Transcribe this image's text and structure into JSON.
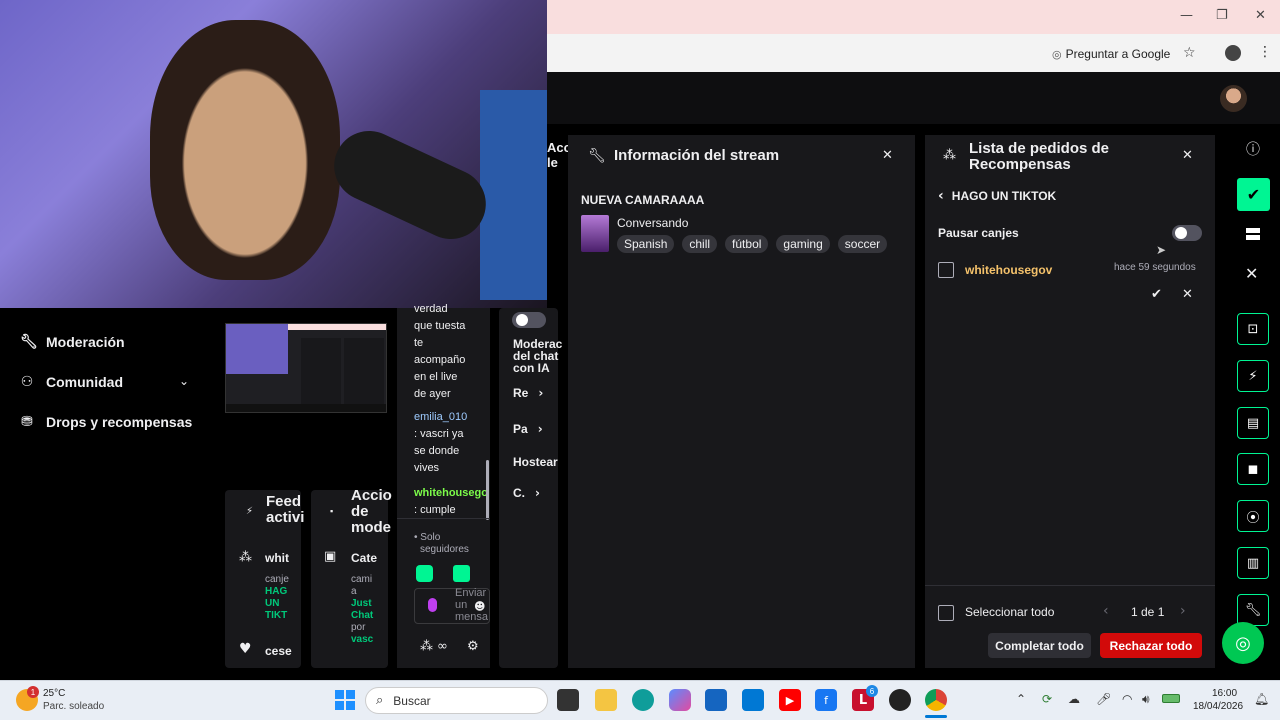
{
  "browser": {
    "ask_google": "Preguntar a Google",
    "minimize_glyph": "—",
    "restore_glyph": "❐",
    "close_glyph": "✕"
  },
  "left_nav": {
    "items": [
      {
        "label": "Moderación",
        "icon": "wrench-icon"
      },
      {
        "label": "Comunidad",
        "icon": "community-icon"
      },
      {
        "label": "Drops y recompensas",
        "icon": "gift-icon"
      }
    ]
  },
  "activity_feed": {
    "title_line1": "Feed",
    "title_line2": "activi",
    "item1_user": "whit",
    "item1_action": "canje",
    "item1_reward_1": "HAG",
    "item1_reward_2": "UN",
    "item1_reward_3": "TIKT",
    "item2_user": "cese"
  },
  "mod_actions": {
    "title_line1": "Accio",
    "title_line2": "de",
    "title_line3": "mode",
    "item_label": "Cate",
    "item_text_1": "cami",
    "item_text_2": "a",
    "item_cat_1": "Just",
    "item_cat_2": "Chat",
    "item_by": "por",
    "item_user": "vasc"
  },
  "chat": {
    "lines": [
      "verdad",
      "que tuesta",
      "te",
      "acompaño",
      "en el live",
      "de ayer"
    ],
    "user2": "emilia_010",
    "msg2_lines": [
      ": vascri ya",
      "se donde",
      "vives"
    ],
    "user3": "whitehousego",
    "msg3": ": cumple",
    "followers_only_1": "Solo",
    "followers_only_2": "seguidores",
    "input_placeholder_1": "Enviar",
    "input_placeholder_2": "un",
    "input_placeholder_3": "mensa"
  },
  "ai_mod": {
    "title_line1": "Moderac",
    "title_line2": "del chat",
    "title_line3": "con IA",
    "item1": "Re",
    "item2": "Pa",
    "item3": "Hostear",
    "item4": "C."
  },
  "cutoff_labels": {
    "line1": "Acc",
    "line2": "le"
  },
  "stream_info": {
    "title": "Información del stream",
    "stream_title": "NUEVA CAMARAAAA",
    "category": "Conversando",
    "tags": [
      "Spanish",
      "chill",
      "fútbol",
      "gaming",
      "soccer"
    ]
  },
  "rewards": {
    "title": "Lista de pedidos de Recompensas",
    "back_label": "HAGO UN TIKTOK",
    "pause_label": "Pausar canjes",
    "pause_enabled": false,
    "requests": [
      {
        "user": "whitehousegov",
        "time": "hace 59 segundos",
        "user_color": "#f5c26b"
      }
    ],
    "select_all": "Seleccionar todo",
    "pagination": "1 de 1",
    "complete_all": "Completar todo",
    "reject_all": "Rechazar todo"
  },
  "colors": {
    "accent_green": "#00f593",
    "reject_red": "#d20a0a",
    "chat_green": "#7cfc4a",
    "chat_blue": "#9ecbff"
  },
  "taskbar": {
    "weather_temp": "25°C",
    "weather_desc": "Parc. soleado",
    "weather_badge": "1",
    "search_placeholder": "Buscar",
    "time": "16:00",
    "date": "18/04/2026",
    "badge_count": "6",
    "lol_letter": "L"
  }
}
